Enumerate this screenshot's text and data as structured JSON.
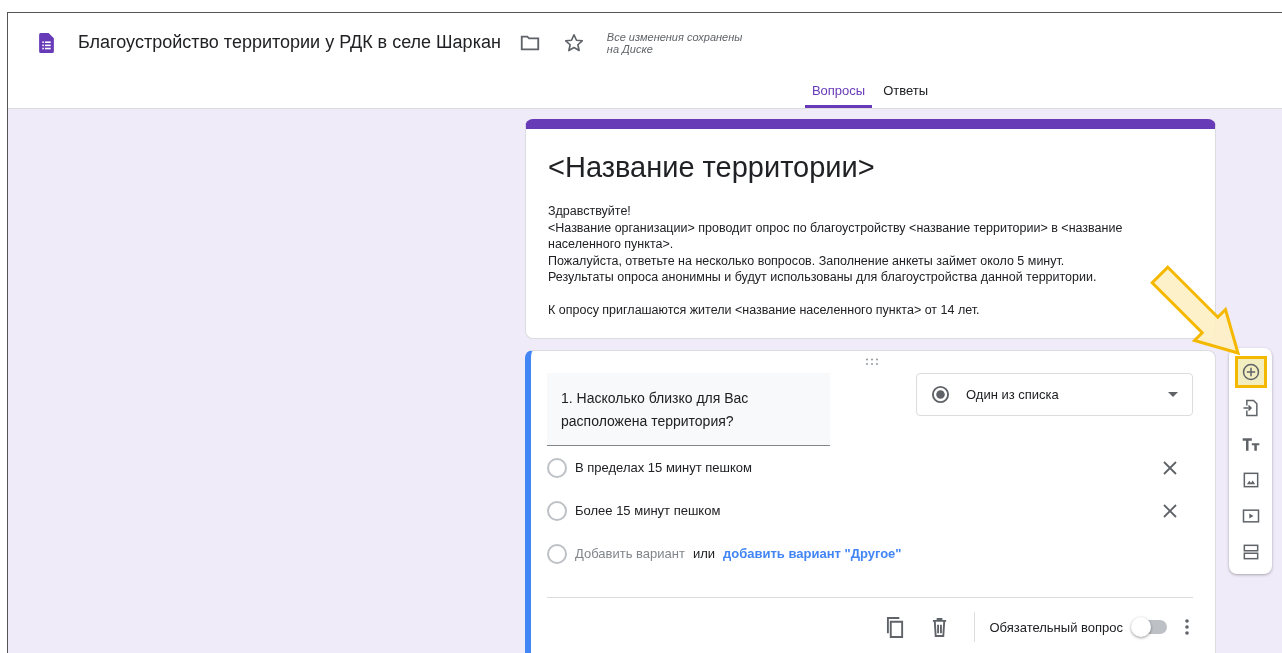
{
  "document": {
    "title": "Благоустройство территории у РДК в селе Шаркан",
    "save_status": "Все изменения сохранены на Диске"
  },
  "tabs": [
    {
      "label": "Вопросы",
      "selected": true
    },
    {
      "label": "Ответы",
      "selected": false
    }
  ],
  "form_header": {
    "title": "<Название территории>",
    "description": [
      {
        "lines": [
          "Здравствуйте!",
          "<Название организации> проводит опрос по благоустройству <название территории> в <название",
          "населенного пункта>.",
          "Пожалуйста, ответьте на несколько вопросов. Заполнение анкеты займет около 5 минут.",
          "Результаты опроса анонимны и будут использованы для благоустройства данной территории."
        ]
      },
      {
        "lines": [
          "К опросу приглашаются жители <название населенного пункта> от 14 лет."
        ]
      }
    ]
  },
  "question": {
    "title": "1. Насколько близко для Вас расположена территория?",
    "type": "Один из списка",
    "options": [
      {
        "label": "В пределах 15 минут пешком"
      },
      {
        "label": "Более 15 минут пешком"
      }
    ],
    "add_option": "Добавить вариант",
    "or": "или",
    "add_other": "добавить вариант \"Другое\"",
    "required_label": "Обязательный вопрос",
    "required": false
  },
  "toolbar": [
    {
      "kind": "add",
      "highlighted": true
    },
    {
      "kind": "import",
      "highlighted": false
    },
    {
      "kind": "text",
      "highlighted": false
    },
    {
      "kind": "image",
      "highlighted": false
    },
    {
      "kind": "video",
      "highlighted": false
    },
    {
      "kind": "section",
      "highlighted": false
    }
  ]
}
